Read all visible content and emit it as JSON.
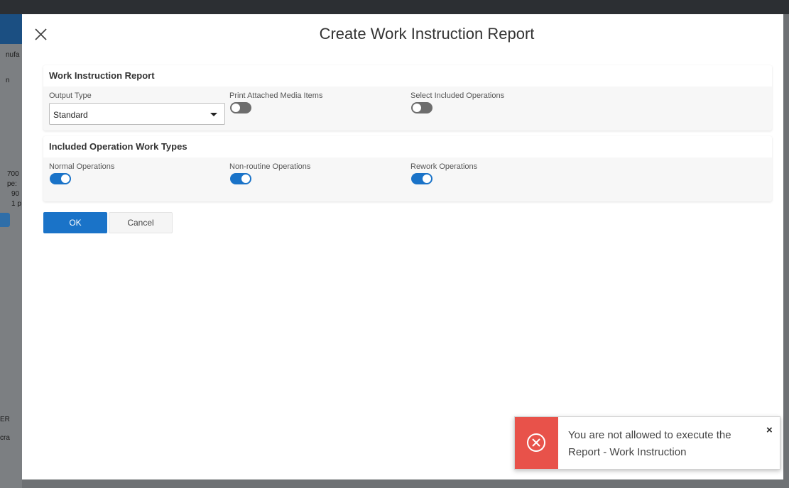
{
  "dialog": {
    "title": "Create Work Instruction Report",
    "ok_label": "OK",
    "cancel_label": "Cancel"
  },
  "report_section": {
    "heading": "Work Instruction Report",
    "output_type": {
      "label": "Output Type",
      "value": "Standard"
    },
    "print_media": {
      "label": "Print Attached Media Items",
      "on": false
    },
    "select_operations": {
      "label": "Select Included Operations",
      "on": false
    }
  },
  "work_types_section": {
    "heading": "Included Operation Work Types",
    "normal": {
      "label": "Normal Operations",
      "on": true
    },
    "nonroutine": {
      "label": "Non-routine Operations",
      "on": true
    },
    "rework": {
      "label": "Rework Operations",
      "on": true
    }
  },
  "toast": {
    "line1": "You are not allowed to execute the",
    "line2": "Report - Work Instruction",
    "close_glyph": "×"
  },
  "background_fragments": [
    "nufa",
    "n",
    "700",
    "pe:",
    "90",
    "1 p",
    "ER",
    "cra"
  ],
  "colors": {
    "accent": "#1a73c8",
    "toggle_off": "#6d6d6d",
    "error": "#e8524a"
  }
}
